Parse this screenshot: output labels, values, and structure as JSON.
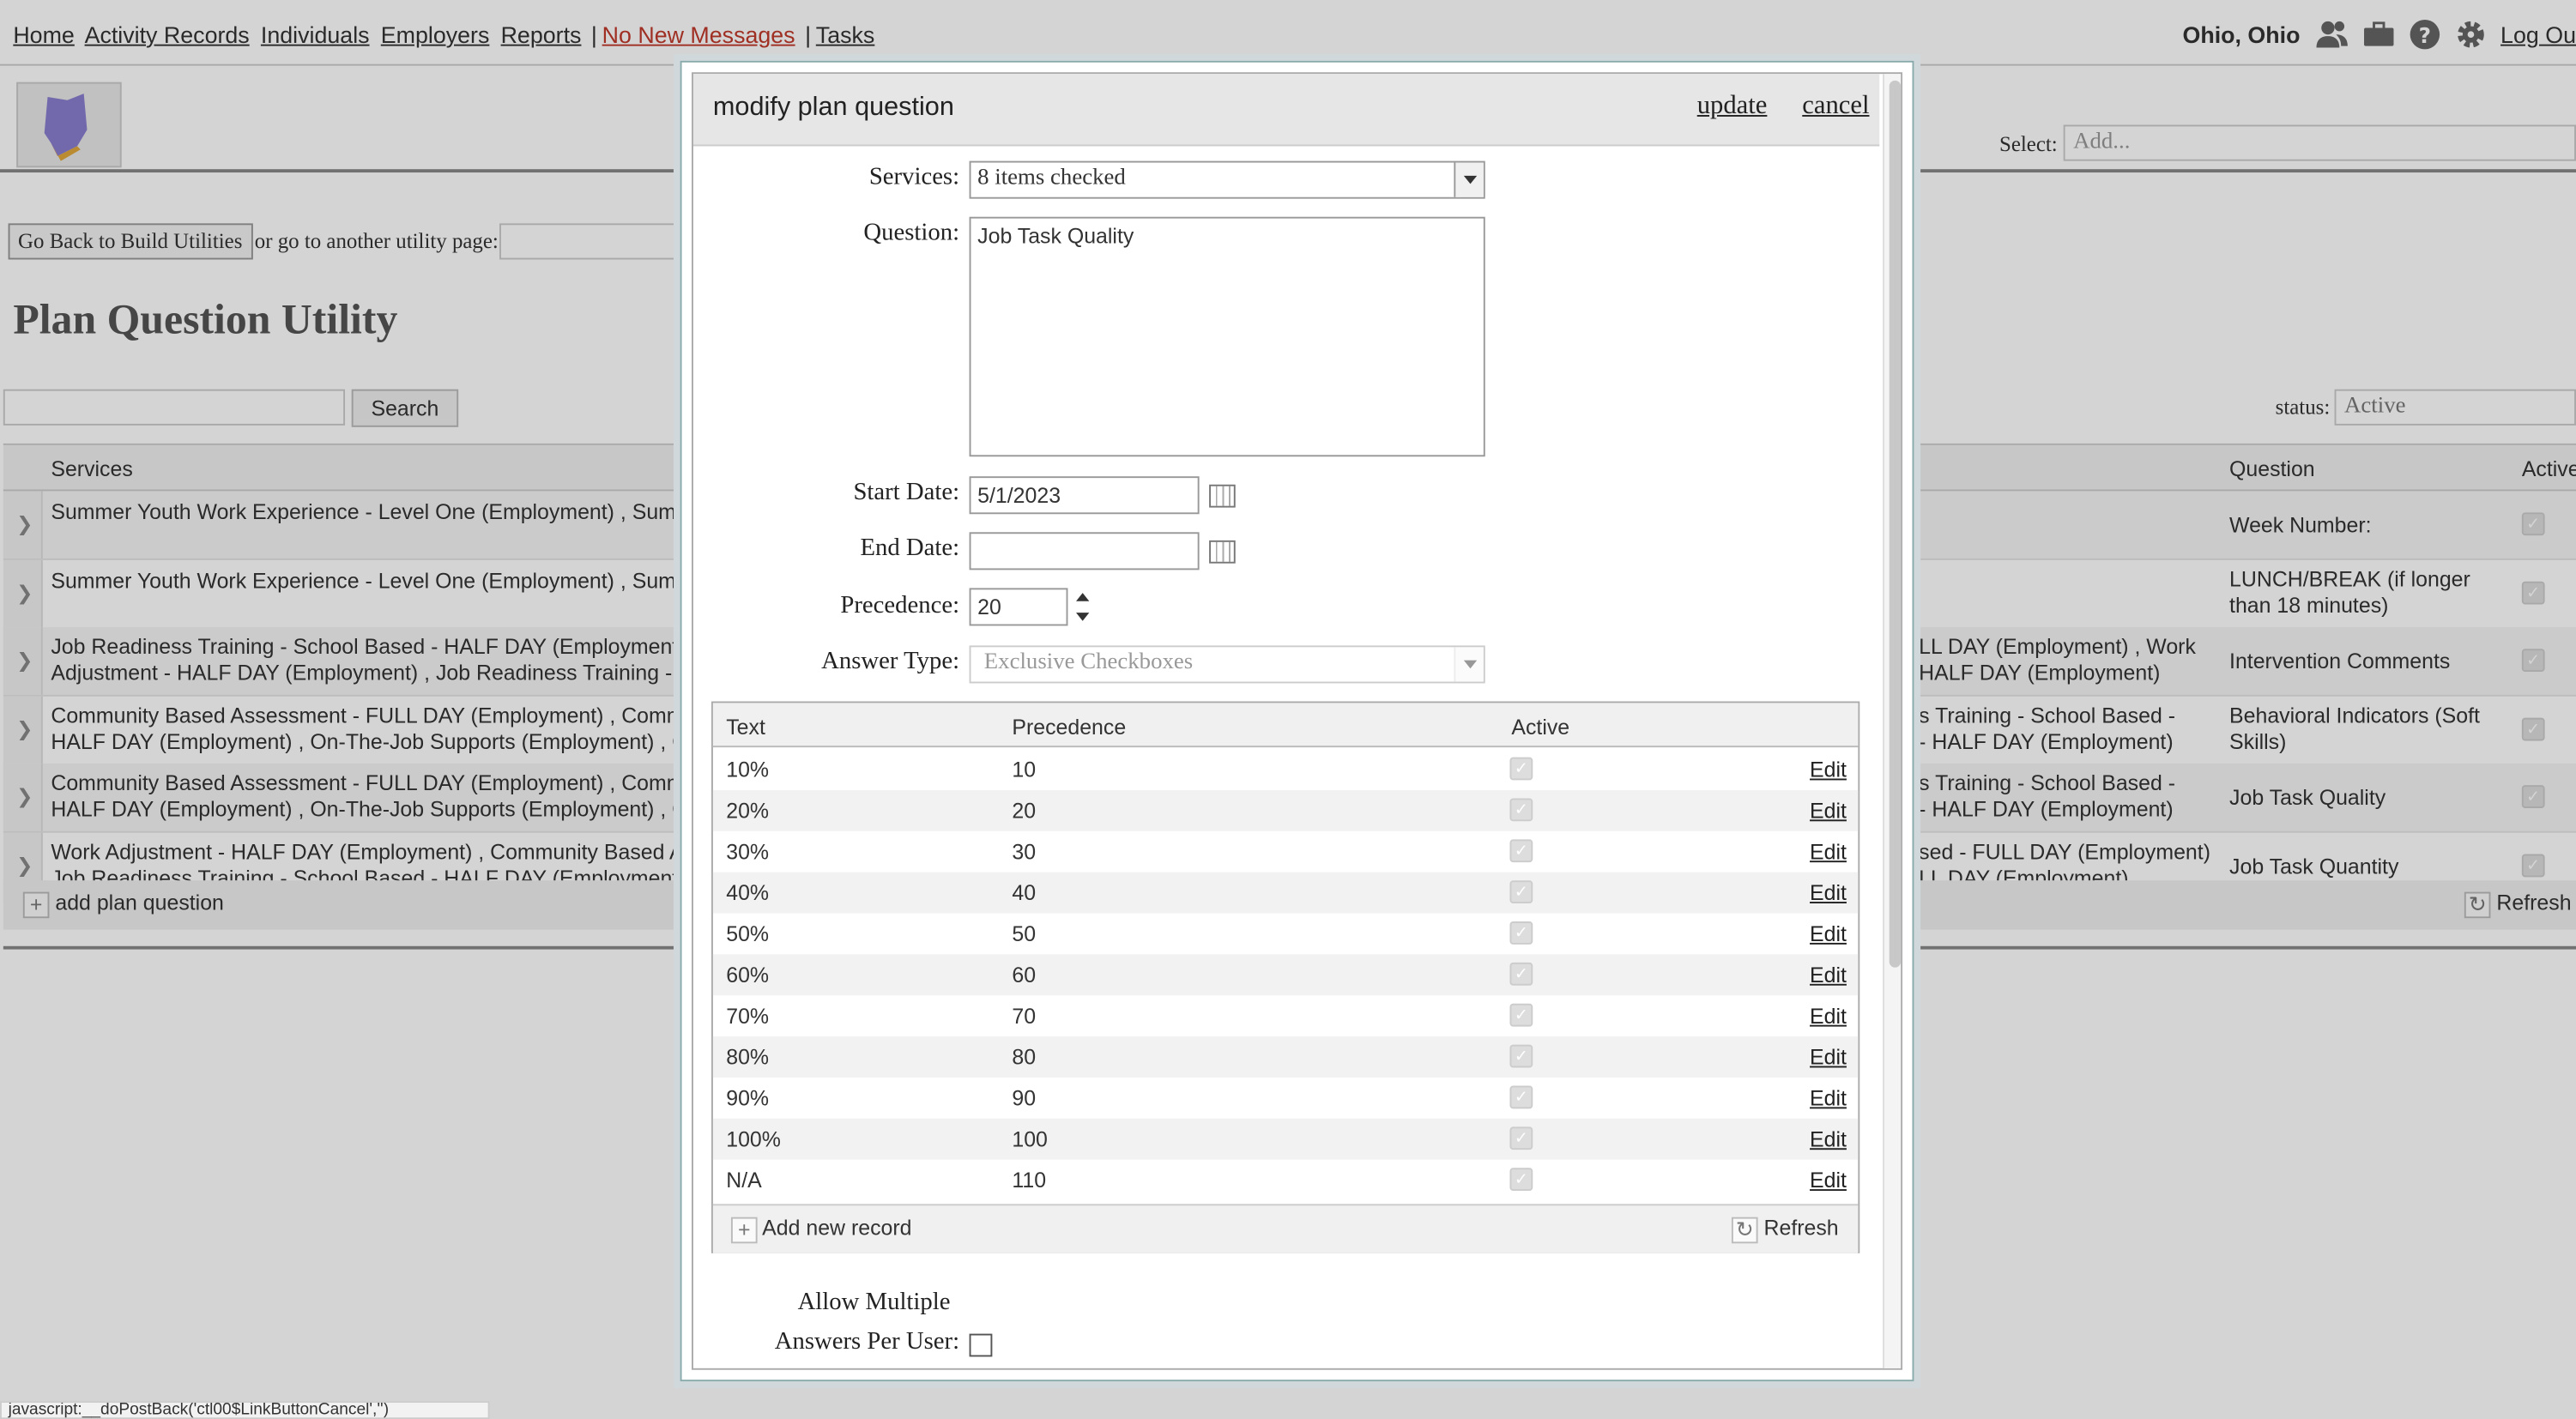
{
  "nav": {
    "links": [
      "Home",
      "Activity Records",
      "Individuals",
      "Employers",
      "Reports"
    ],
    "messages": "No New Messages",
    "tasks": "Tasks",
    "location": "Ohio, Ohio",
    "logout": "Log Ou"
  },
  "header": {
    "select_label": "Select:",
    "select_value": "Add..."
  },
  "utility": {
    "back_button": "Go Back to Build Utilities",
    "or_text": "or go to another utility page:",
    "title": "Plan Question Utility",
    "search_button": "Search",
    "status_label": "status:",
    "status_value": "Active"
  },
  "grid": {
    "headers": {
      "services": "Services",
      "question": "Question",
      "active": "Active"
    },
    "rows": [
      {
        "svc": [
          "Summer Youth Work Experience - Level One (Employment) , Summe"
        ],
        "svc2": [],
        "question": "Week Number:"
      },
      {
        "svc": [
          "Summer Youth Work Experience - Level One (Employment) , Summe"
        ],
        "svc2": [],
        "question": "LUNCH/BREAK (if longer than 18 minutes)"
      },
      {
        "svc": [
          "Job Readiness Training - School Based - HALF DAY (Employment) , C",
          "Adjustment - HALF DAY (Employment) , Job Readiness Training - Sc"
        ],
        "svc2": [
          "LL DAY (Employment) , Work",
          "HALF DAY (Employment)"
        ],
        "question": "Intervention Comments"
      },
      {
        "svc": [
          "Community Based Assessment - FULL DAY (Employment) , Commun",
          "HALF DAY (Employment) , On-The-Job Supports (Employment) , On-"
        ],
        "svc2": [
          "s Training - School Based -",
          "- HALF DAY (Employment)"
        ],
        "question": "Behavioral Indicators (Soft Skills)"
      },
      {
        "svc": [
          "Community Based Assessment - FULL DAY (Employment) , Commun",
          "HALF DAY (Employment) , On-The-Job Supports (Employment) , On-"
        ],
        "svc2": [
          "s Training - School Based -",
          "- HALF DAY (Employment)"
        ],
        "question": "Job Task Quality"
      },
      {
        "svc": [
          "Work Adjustment - HALF DAY (Employment) , Community Based Ass",
          "Job Readiness Training - School Based - HALF DAY (Employment) , C"
        ],
        "svc2": [
          "sed - FULL DAY (Employment) ,",
          "LL DAY (Employment)"
        ],
        "question": "Job Task Quantity"
      }
    ],
    "add_label": "add plan question",
    "refresh_label": "Refresh"
  },
  "modal": {
    "title": "modify plan question",
    "update": "update",
    "cancel": "cancel",
    "labels": {
      "services": "Services:",
      "question": "Question:",
      "start_date": "Start Date:",
      "end_date": "End Date:",
      "precedence": "Precedence:",
      "answer_type": "Answer Type:",
      "allow_1": "Allow Multiple",
      "allow_2": "Answers Per User:"
    },
    "services_value": "8 items checked",
    "question_value": "Job Task Quality",
    "start_date": "5/1/2023",
    "end_date": "",
    "precedence": "20",
    "answer_type": "Exclusive Checkboxes",
    "answers": {
      "headers": {
        "text": "Text",
        "precedence": "Precedence",
        "active": "Active"
      },
      "rows": [
        {
          "text": "10%",
          "precedence": "10"
        },
        {
          "text": "20%",
          "precedence": "20"
        },
        {
          "text": "30%",
          "precedence": "30"
        },
        {
          "text": "40%",
          "precedence": "40"
        },
        {
          "text": "50%",
          "precedence": "50"
        },
        {
          "text": "60%",
          "precedence": "60"
        },
        {
          "text": "70%",
          "precedence": "70"
        },
        {
          "text": "80%",
          "precedence": "80"
        },
        {
          "text": "90%",
          "precedence": "90"
        },
        {
          "text": "100%",
          "precedence": "100"
        },
        {
          "text": "N/A",
          "precedence": "110"
        }
      ],
      "edit_label": "Edit",
      "add_label": "Add new record",
      "refresh_label": "Refresh"
    }
  },
  "statusbar": "javascript:__doPostBack('ctl00$LinkButtonCancel','')",
  "colors": {
    "link": "#333333",
    "messages_link": "#c0392b",
    "modal_header": "#e6e6e6"
  }
}
